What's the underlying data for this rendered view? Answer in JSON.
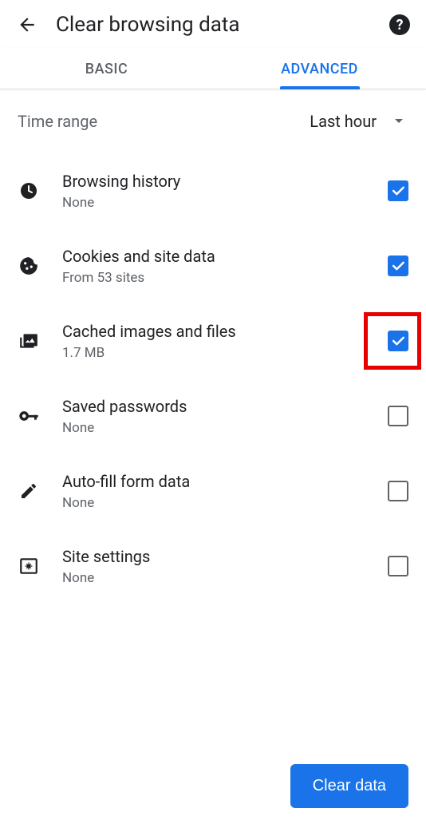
{
  "header": {
    "title": "Clear browsing data"
  },
  "tabs": {
    "basic": "BASIC",
    "advanced": "ADVANCED",
    "active": "advanced"
  },
  "time_range": {
    "label": "Time range",
    "value": "Last hour"
  },
  "items": [
    {
      "icon": "clock-icon",
      "title": "Browsing history",
      "sub": "None",
      "checked": true,
      "highlighted": false
    },
    {
      "icon": "cookie-icon",
      "title": "Cookies and site data",
      "sub": "From 53 sites",
      "checked": true,
      "highlighted": false
    },
    {
      "icon": "image-icon",
      "title": "Cached images and files",
      "sub": "1.7 MB",
      "checked": true,
      "highlighted": true
    },
    {
      "icon": "key-icon",
      "title": "Saved passwords",
      "sub": "None",
      "checked": false,
      "highlighted": false
    },
    {
      "icon": "pencil-icon",
      "title": "Auto-fill form data",
      "sub": "None",
      "checked": false,
      "highlighted": false
    },
    {
      "icon": "settings-card-icon",
      "title": "Site settings",
      "sub": "None",
      "checked": false,
      "highlighted": false
    }
  ],
  "footer": {
    "clear_label": "Clear data"
  }
}
